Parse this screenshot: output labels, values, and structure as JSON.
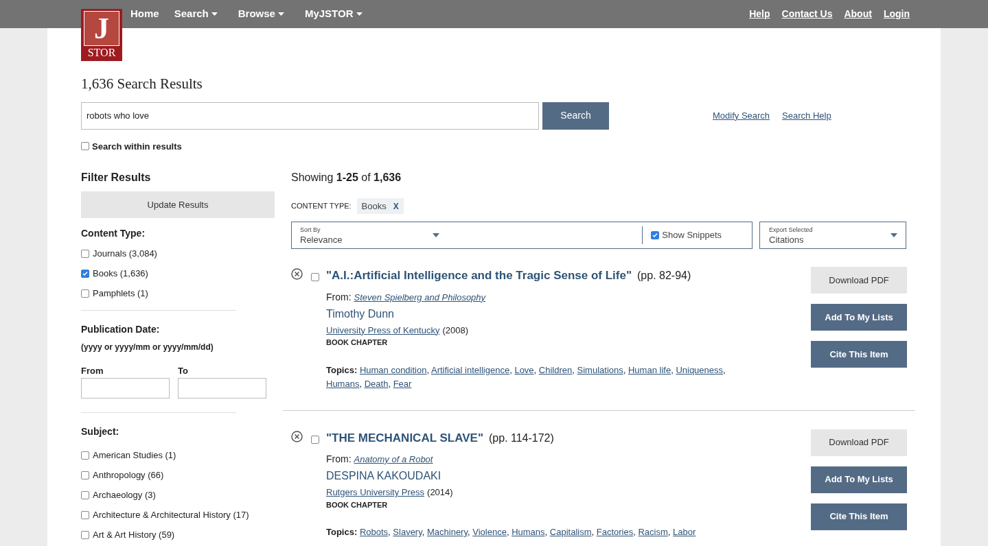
{
  "logo": {
    "letter": "J",
    "word": "STOR"
  },
  "nav": [
    {
      "label": "Home",
      "dropdown": false
    },
    {
      "label": "Search",
      "dropdown": true
    },
    {
      "label": "Browse",
      "dropdown": true
    },
    {
      "label": "MyJSTOR",
      "dropdown": true
    }
  ],
  "utility_links": [
    "Help",
    "Contact Us",
    "About",
    "Login"
  ],
  "results_title": "1,636 Search Results",
  "search": {
    "value": "robots who love",
    "button": "Search",
    "links": [
      "Modify Search",
      "Search Help"
    ],
    "within": {
      "label": "Search within results",
      "checked": false
    }
  },
  "filters": {
    "title": "Filter Results",
    "update_button": "Update Results",
    "content_type": {
      "title": "Content Type:",
      "options": [
        {
          "label": "Journals (3,084)",
          "checked": false
        },
        {
          "label": "Books (1,636)",
          "checked": true
        },
        {
          "label": "Pamphlets (1)",
          "checked": false
        }
      ]
    },
    "publication_date": {
      "title": "Publication Date:",
      "hint": "(yyyy or yyyy/mm or yyyy/mm/dd)",
      "from": "From",
      "to": "To"
    },
    "subject": {
      "title": "Subject:",
      "options": [
        {
          "label": "American Studies (1)",
          "checked": false
        },
        {
          "label": "Anthropology (66)",
          "checked": false
        },
        {
          "label": "Archaeology (3)",
          "checked": false
        },
        {
          "label": "Architecture & Architectural History (17)",
          "checked": false
        },
        {
          "label": "Art & Art History (59)",
          "checked": false
        }
      ]
    }
  },
  "showing": "Showing **1-25** of **1,636**",
  "active_filter": {
    "label": "CONTENT TYPE:",
    "value": "Books",
    "remove": "X"
  },
  "sort": {
    "label": "Sort By",
    "value": "Relevance",
    "snippets": {
      "label": "Show Snippets",
      "checked": true
    }
  },
  "export": {
    "label": "Export Selected",
    "value": "Citations"
  },
  "results": [
    {
      "selected": false,
      "title": "\"A.I.:Artificial Intelligence and the Tragic Sense of Life\"",
      "pages": "(pp. 82-94)",
      "from_label": "From:",
      "from": "Steven Spielberg and Philosophy",
      "author": "Timothy Dunn",
      "publisher": "University Press of Kentucky",
      "year": "(2008)",
      "type": "BOOK CHAPTER",
      "topics_label": "Topics:",
      "topics": [
        {
          "text": "Human condition",
          "after": ","
        },
        {
          "text": "Artificial intelligence",
          "after": ","
        },
        {
          "text": "Love",
          "after": ","
        },
        {
          "text": "Children",
          "after": ","
        },
        {
          "text": "Simulations",
          "after": ","
        },
        {
          "text": "Human life",
          "after": ","
        },
        {
          "text": "Uniqueness",
          "after": ","
        },
        {
          "text": "Humans",
          "after": ","
        },
        {
          "text": "Death",
          "after": ","
        },
        {
          "text": "Fear"
        }
      ],
      "buttons": [
        "Download PDF",
        "Add To My Lists",
        "Cite This Item"
      ]
    },
    {
      "selected": false,
      "title": "\"THE MECHANICAL SLAVE\"",
      "pages": "(pp. 114-172)",
      "from_label": "From:",
      "from": "Anatomy of a Robot",
      "author": "DESPINA KAKOUDAKI",
      "publisher": "Rutgers University Press",
      "year": "(2014)",
      "type": "BOOK CHAPTER",
      "topics_label": "Topics:",
      "topics": [
        {
          "text": "Robots",
          "after": ","
        },
        {
          "text": "Slavery",
          "after": ","
        },
        {
          "text": "Machinery",
          "after": ","
        },
        {
          "text": "Violence",
          "after": ","
        },
        {
          "text": "Humans",
          "after": ","
        },
        {
          "text": "Capitalism",
          "after": ","
        },
        {
          "text": "Factories",
          "after": ","
        },
        {
          "text": "Racism",
          "after": ","
        },
        {
          "text": "Labor"
        }
      ],
      "buttons": [
        "Download PDF",
        "Add To My Lists",
        "Cite This Item"
      ]
    }
  ]
}
